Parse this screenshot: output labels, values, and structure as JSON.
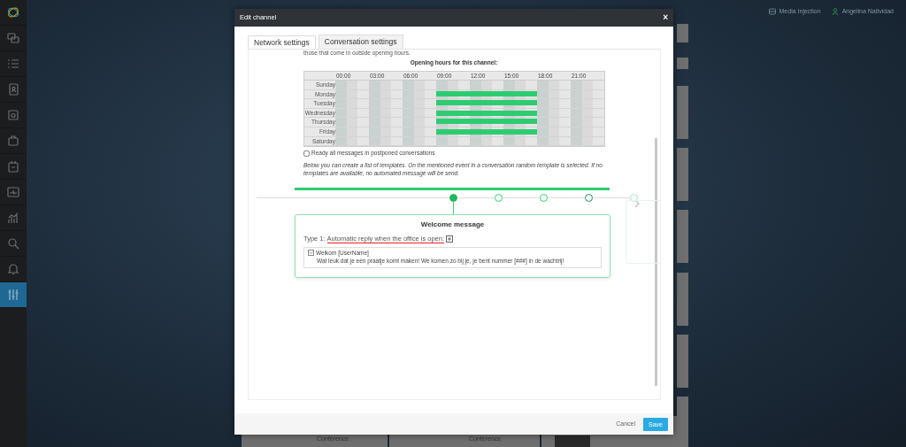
{
  "sidebar": {
    "items": [
      {
        "selected": false
      },
      {
        "selected": false
      },
      {
        "selected": false
      },
      {
        "selected": false
      },
      {
        "selected": false
      },
      {
        "selected": false
      },
      {
        "selected": false
      },
      {
        "selected": false
      },
      {
        "selected": false
      },
      {
        "selected": false
      },
      {
        "selected": true
      }
    ]
  },
  "top_bar": {
    "media_injection": "Media Injection",
    "user": "Angelina Natividad"
  },
  "background_cards": [
    {
      "label": "Conference"
    },
    {
      "label": "Conference"
    }
  ],
  "modal": {
    "title": "Edit channel",
    "close": "×",
    "tabs": [
      {
        "label": "Network settings",
        "selected": true
      },
      {
        "label": "Conversation settings",
        "selected": false
      }
    ],
    "intro_text": "those that come in outside opening hours.",
    "schedule": {
      "title": "Opening hours for this channel:",
      "hour_labels": [
        "00:00",
        "03:00",
        "06:00",
        "09:00",
        "12:00",
        "15:00",
        "18:00",
        "21:00"
      ],
      "days": [
        {
          "label": "Sunday",
          "open": [
            false,
            false,
            false,
            false,
            false,
            false,
            false,
            false,
            false,
            false,
            false,
            false,
            false,
            false,
            false,
            false,
            false,
            false,
            false,
            false,
            false,
            false,
            false,
            false
          ]
        },
        {
          "label": "Monday",
          "open": [
            false,
            false,
            false,
            false,
            false,
            false,
            false,
            false,
            false,
            true,
            true,
            true,
            true,
            true,
            true,
            true,
            true,
            true,
            false,
            false,
            false,
            false,
            false,
            false
          ]
        },
        {
          "label": "Tuesday",
          "open": [
            false,
            false,
            false,
            false,
            false,
            false,
            false,
            false,
            false,
            true,
            true,
            true,
            true,
            true,
            true,
            true,
            true,
            true,
            false,
            false,
            false,
            false,
            false,
            false
          ]
        },
        {
          "label": "Wednesday",
          "open": [
            false,
            false,
            false,
            false,
            false,
            false,
            false,
            false,
            false,
            true,
            true,
            true,
            true,
            true,
            true,
            true,
            true,
            true,
            false,
            false,
            false,
            false,
            false,
            false
          ]
        },
        {
          "label": "Thursday",
          "open": [
            false,
            false,
            false,
            false,
            false,
            false,
            false,
            false,
            false,
            true,
            true,
            true,
            true,
            true,
            true,
            true,
            true,
            true,
            false,
            false,
            false,
            false,
            false,
            false
          ]
        },
        {
          "label": "Friday",
          "open": [
            false,
            false,
            false,
            false,
            false,
            false,
            false,
            false,
            false,
            true,
            true,
            true,
            true,
            true,
            true,
            true,
            true,
            true,
            false,
            false,
            false,
            false,
            false,
            false
          ]
        },
        {
          "label": "Saturday",
          "open": [
            false,
            false,
            false,
            false,
            false,
            false,
            false,
            false,
            false,
            false,
            false,
            false,
            false,
            false,
            false,
            false,
            false,
            false,
            false,
            false,
            false,
            false,
            false,
            false
          ]
        }
      ]
    },
    "read_all": {
      "label": "Ready all messages in postponed conversations",
      "checked": false
    },
    "templates_note": "Below you can create a list of templates. On the mentioned event in a conversation random template is selected. If no templates are available, no automated message will be send.",
    "steps": [
      {
        "selected": true
      },
      {
        "selected": false
      },
      {
        "selected": false
      },
      {
        "selected": false
      },
      {
        "selected": false
      }
    ],
    "message_card": {
      "title": "Welcome message",
      "type_prefix": "Type 1:",
      "type_label": "Automatic reply when the office is open:",
      "templates": [
        {
          "subject": "Welkom [UserName]",
          "body": "Wat leuk dat je een praatje komt maken! We komen zo bij je, je bent nummer [###] in de wachtrij!"
        }
      ]
    },
    "footer": {
      "cancel": "Cancel",
      "save": "Save"
    }
  }
}
